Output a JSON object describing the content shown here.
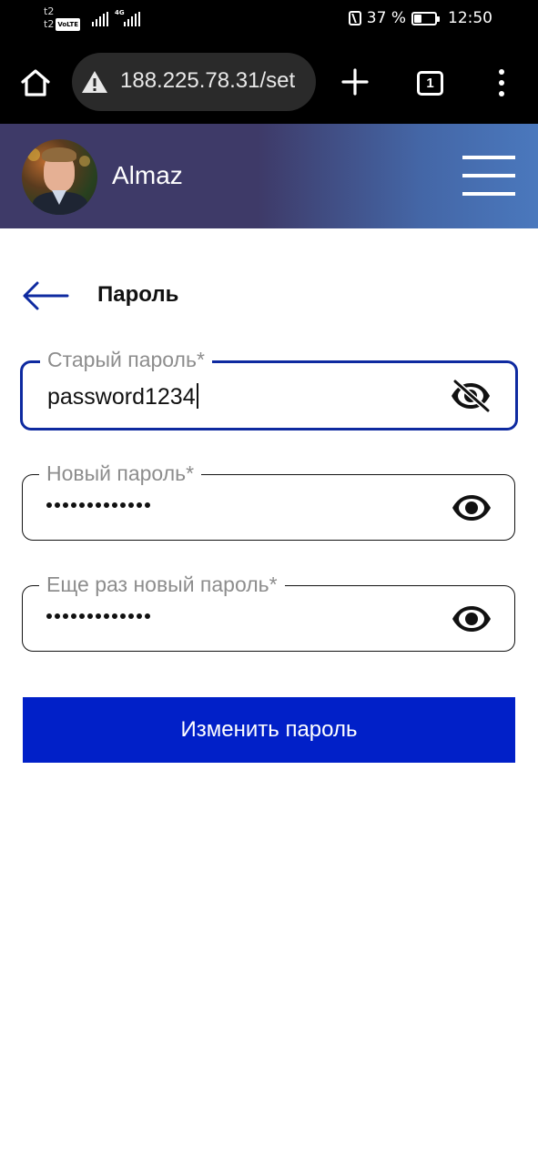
{
  "status_bar": {
    "carrier_line1": "t2",
    "carrier_line2": "t2",
    "volte": "VoLTE",
    "network": "4G",
    "battery_percent": "37 %",
    "battery_level": 0.37,
    "time": "12:50"
  },
  "browser": {
    "url": "188.225.78.31/set",
    "tab_count": "1",
    "icons": [
      "home-icon",
      "warning-icon",
      "plus-icon",
      "tabs-icon",
      "more-vert-icon"
    ]
  },
  "header": {
    "user_name": "Almaz",
    "icons": [
      "avatar",
      "hamburger-menu-icon"
    ],
    "gradient_colors": [
      "#3e3a68",
      "#4a78bd"
    ]
  },
  "page": {
    "title": "Пароль",
    "back_icon": "arrow-left-icon"
  },
  "form": {
    "old_password": {
      "label": "Старый пароль*",
      "value": "password1234",
      "visible": true,
      "icon": "eye-off-icon"
    },
    "new_password": {
      "label": "Новый пароль*",
      "masked_length": 13,
      "visible": false,
      "icon": "eye-icon"
    },
    "repeat_password": {
      "label": "Еще раз новый пароль*",
      "masked_length": 13,
      "visible": false,
      "icon": "eye-icon"
    },
    "submit_label": "Изменить пароль",
    "accent_color": "#0120c8",
    "focus_color": "#0e2aa0"
  }
}
